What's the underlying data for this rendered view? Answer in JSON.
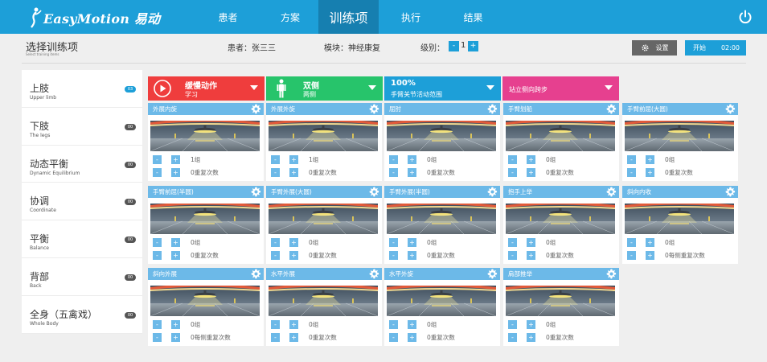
{
  "app": {
    "brand_en": "EasyMotion",
    "brand_zh": "易动"
  },
  "nav": {
    "tabs": [
      {
        "label": "患者",
        "active": false
      },
      {
        "label": "方案",
        "active": false
      },
      {
        "label": "训练项",
        "active": true
      },
      {
        "label": "执行",
        "active": false
      },
      {
        "label": "结果",
        "active": false
      }
    ]
  },
  "header": {
    "title": "选择训练项",
    "subtitle": "Select training items",
    "patient": "患者：张三三",
    "module": "模块：神经康复",
    "level_label": "级别：",
    "level_minus": "-",
    "level_value": "1",
    "level_plus": "+",
    "settings_label": "设置",
    "start_label": "开始",
    "timer": "02:00"
  },
  "sidebar": {
    "items": [
      {
        "zh": "上肢",
        "en": "Upper limb",
        "count": "03",
        "active": true
      },
      {
        "zh": "下肢",
        "en": "The legs",
        "count": "00",
        "active": false
      },
      {
        "zh": "动态平衡",
        "en": "Dynamic Equilibrium",
        "count": "00",
        "active": false
      },
      {
        "zh": "协调",
        "en": "Coordinate",
        "count": "00",
        "active": false
      },
      {
        "zh": "平衡",
        "en": "Balance",
        "count": "00",
        "active": false
      },
      {
        "zh": "背部",
        "en": "Back",
        "count": "00",
        "active": false
      },
      {
        "zh": "全身（五禽戏）",
        "en": "Whole Body",
        "count": "00",
        "active": false
      }
    ]
  },
  "filters": [
    {
      "title": "缓慢动作",
      "sub": "学习",
      "color": "#ef3d3d",
      "icon": "play-icon"
    },
    {
      "title": "双侧",
      "sub": "两侧",
      "color": "#27c46b",
      "icon": "person-icon"
    },
    {
      "title": "100%",
      "sub": "手臂关节活动范围",
      "color": "#1d9fd8",
      "icon": ""
    },
    {
      "title": "",
      "sub": "站立侧向跨步",
      "color": "#e6408f",
      "icon": ""
    }
  ],
  "cards": [
    {
      "title": "外展内旋",
      "sets": "1组",
      "reps": "0重复次数",
      "active": true
    },
    {
      "title": "外展外旋",
      "sets": "1组",
      "reps": "0重复次数",
      "active": true
    },
    {
      "title": "屈肘",
      "sets": "0组",
      "reps": "0重复次数",
      "active": false
    },
    {
      "title": "手臂划船",
      "sets": "0组",
      "reps": "0重复次数",
      "active": false
    },
    {
      "title": "手臂前屈(大圆)",
      "sets": "0组",
      "reps": "0重复次数",
      "active": false
    },
    {
      "title": "手臂前屈(半圆)",
      "sets": "0组",
      "reps": "0重复次数",
      "active": false
    },
    {
      "title": "手臂外展(大圆)",
      "sets": "0组",
      "reps": "0重复次数",
      "active": false
    },
    {
      "title": "手臂外展(半圆)",
      "sets": "0组",
      "reps": "0重复次数",
      "active": false
    },
    {
      "title": "抱手上举",
      "sets": "0组",
      "reps": "0重复次数",
      "active": false
    },
    {
      "title": "斜向内收",
      "sets": "0组",
      "reps": "0每侧重复次数",
      "active": false
    },
    {
      "title": "斜向外展",
      "sets": "0组",
      "reps": "0每侧重复次数",
      "active": false
    },
    {
      "title": "水平外展",
      "sets": "0组",
      "reps": "0重复次数",
      "active": false
    },
    {
      "title": "水平外旋",
      "sets": "0组",
      "reps": "0重复次数",
      "active": false
    },
    {
      "title": "肩部推举",
      "sets": "0组",
      "reps": "0重复次数",
      "active": false
    }
  ],
  "colors": {
    "primary": "#1d9fd8",
    "card_bar": "#6cb9e8",
    "red": "#ef3d3d",
    "green": "#27c46b",
    "pink": "#e6408f"
  }
}
